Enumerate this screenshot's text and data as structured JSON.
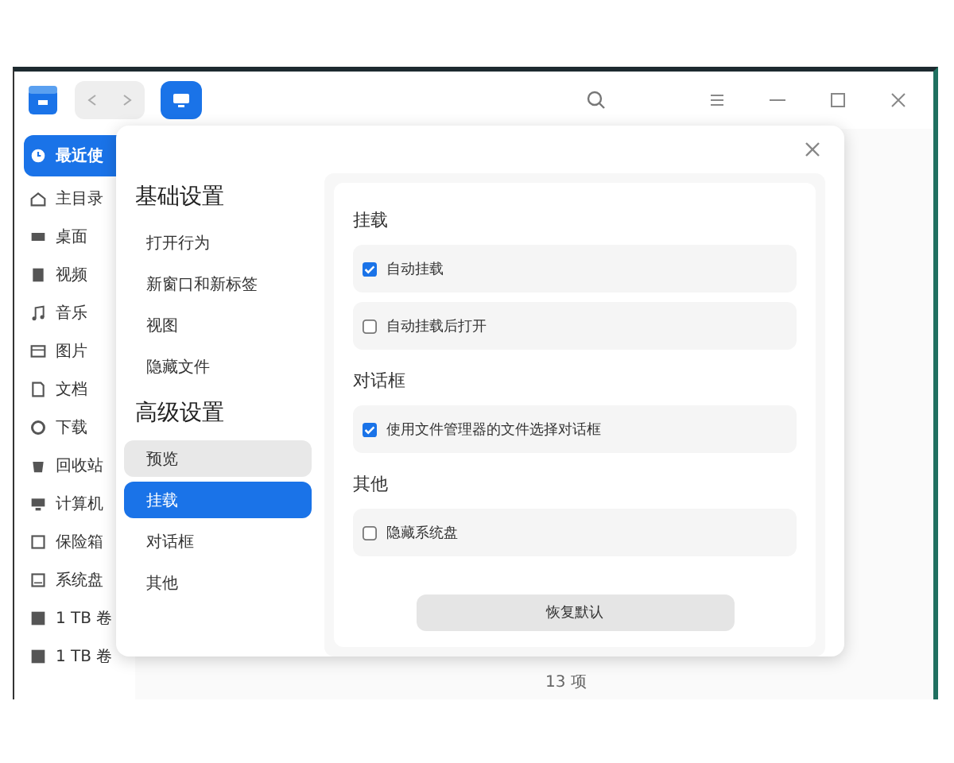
{
  "sidebar": {
    "items": [
      {
        "label": "最近使",
        "selected": true
      },
      {
        "label": "主目录",
        "selected": false
      },
      {
        "label": "桌面",
        "selected": false
      },
      {
        "label": "视频",
        "selected": false
      },
      {
        "label": "音乐",
        "selected": false
      },
      {
        "label": "图片",
        "selected": false
      },
      {
        "label": "文档",
        "selected": false
      },
      {
        "label": "下载",
        "selected": false
      },
      {
        "label": "回收站",
        "selected": false
      },
      {
        "label": "计算机",
        "selected": false
      },
      {
        "label": "保险箱",
        "selected": false
      },
      {
        "label": "系统盘",
        "selected": false
      },
      {
        "label": "1 TB 卷",
        "selected": false
      },
      {
        "label": "1 TB 卷",
        "selected": false
      }
    ]
  },
  "status_bar": {
    "text": "13 项"
  },
  "settings_dialog": {
    "nav": [
      {
        "title": "基础设置",
        "items": [
          {
            "label": "打开行为",
            "selected": false,
            "hovered": false
          },
          {
            "label": "新窗口和新标签",
            "selected": false,
            "hovered": false
          },
          {
            "label": "视图",
            "selected": false,
            "hovered": false
          },
          {
            "label": "隐藏文件",
            "selected": false,
            "hovered": false
          }
        ]
      },
      {
        "title": "高级设置",
        "items": [
          {
            "label": "预览",
            "selected": false,
            "hovered": true
          },
          {
            "label": "挂载",
            "selected": true,
            "hovered": false
          },
          {
            "label": "对话框",
            "selected": false,
            "hovered": false
          },
          {
            "label": "其他",
            "selected": false,
            "hovered": false
          }
        ]
      }
    ],
    "sections": [
      {
        "title": "挂载",
        "options": [
          {
            "label": "自动挂载",
            "checked": true
          },
          {
            "label": "自动挂载后打开",
            "checked": false
          }
        ]
      },
      {
        "title": "对话框",
        "options": [
          {
            "label": "使用文件管理器的文件选择对话框",
            "checked": true
          }
        ]
      },
      {
        "title": "其他",
        "options": [
          {
            "label": "隐藏系统盘",
            "checked": false
          }
        ]
      }
    ],
    "reset_button": "恢复默认"
  }
}
